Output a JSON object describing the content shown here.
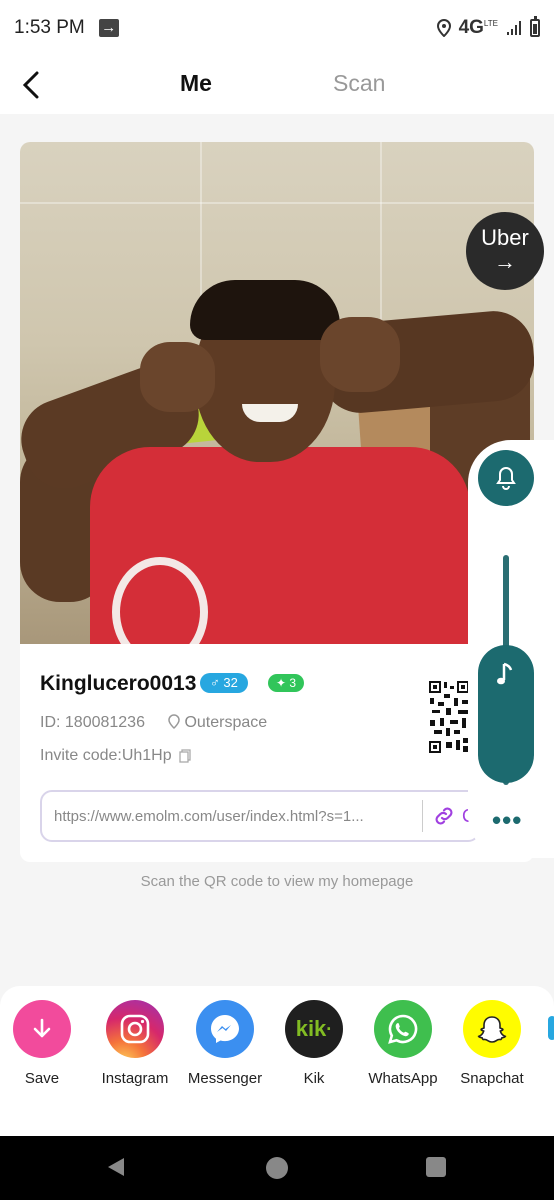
{
  "status_bar": {
    "time": "1:53 PM",
    "network": "4G",
    "network_sub": "LTE"
  },
  "header": {
    "tabs": [
      {
        "label": "Me"
      },
      {
        "label": "Scan"
      }
    ]
  },
  "floating": {
    "uber_label": "Uber"
  },
  "profile": {
    "username": "Kinglucero0013",
    "gender_badge": "♂ 32",
    "level_badge": "✦ 3",
    "id_text": "ID: 180081236",
    "location": "Outerspace",
    "invite_code": "Invite code:Uh1Hp",
    "url": "https://www.emolm.com/user/index.html?s=1...",
    "copy_label": "C"
  },
  "hint": "Scan the QR code to view my homepage",
  "share": {
    "items": [
      {
        "label": "Save",
        "color": "#f24b9c",
        "icon": "download-icon"
      },
      {
        "label": "Instagram",
        "color": "#d6286b",
        "icon": "instagram-icon"
      },
      {
        "label": "Messenger",
        "color": "#3b8ff0",
        "icon": "messenger-icon"
      },
      {
        "label": "Kik",
        "color": "#1f1f1f",
        "icon": "kik-icon"
      },
      {
        "label": "WhatsApp",
        "color": "#3fbf4e",
        "icon": "whatsapp-icon"
      },
      {
        "label": "Snapchat",
        "color": "#fffc00",
        "icon": "snapchat-icon"
      }
    ]
  },
  "colors": {
    "accent": "#1c6a6f",
    "link": "#a040e0"
  }
}
